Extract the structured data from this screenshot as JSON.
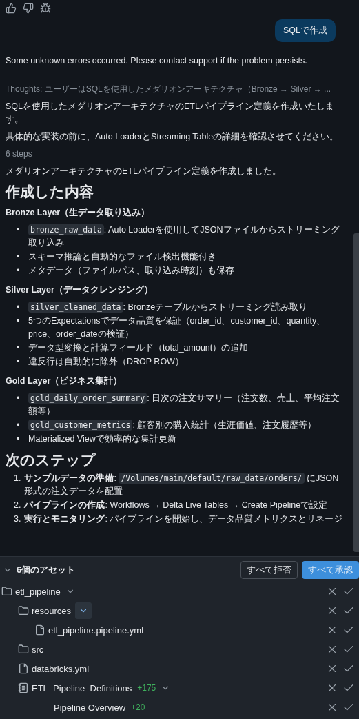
{
  "message_actions": [
    {
      "kind": "like"
    },
    {
      "kind": "dislike"
    },
    {
      "kind": "bug"
    }
  ],
  "user_message": "SQLで作成",
  "error": "Some unknown errors occurred. Please contact support if the problem persists.",
  "thoughts": "Thoughts: ユーザーはSQLを使用したメダリオンアーキテクチャ（Bronze → Silver → ...",
  "blocks": [
    {
      "kind": "paragraph",
      "text": "SQLを使用したメダリオンアーキテクチャのETLパイプライン定義を作成いたします。"
    },
    {
      "kind": "paragraph",
      "text": "具体的な実装の前に、Auto LoaderとStreaming Tableの詳細を確認させてください。"
    },
    {
      "kind": "steps",
      "text": "6 steps"
    },
    {
      "kind": "paragraph",
      "text": "メダリオンアーキテクチャのETLパイプライン定義を作成しました。"
    },
    {
      "kind": "heading",
      "text": "作成した内容"
    },
    {
      "kind": "subheading",
      "text": "Bronze Layer（生データ取り込み）"
    },
    {
      "kind": "list",
      "items": [
        {
          "marker": "•",
          "parts": [
            {
              "kind": "code",
              "text": "bronze_raw_data"
            },
            {
              "kind": "text",
              "text": ": Auto Loaderを使用してJSONファイルからストリーミング取り込み"
            }
          ]
        },
        {
          "marker": "•",
          "parts": [
            {
              "kind": "text",
              "text": "スキーマ推論と自動的なファイル検出機能付き"
            }
          ]
        },
        {
          "marker": "•",
          "parts": [
            {
              "kind": "text",
              "text": "メタデータ（ファイルパス、取り込み時刻）も保存"
            }
          ]
        }
      ]
    },
    {
      "kind": "subheading",
      "text": "Silver Layer（データクレンジング）"
    },
    {
      "kind": "list",
      "items": [
        {
          "marker": "•",
          "parts": [
            {
              "kind": "code",
              "text": "silver_cleaned_data"
            },
            {
              "kind": "text",
              "text": ": Bronzeテーブルからストリーミング読み取り"
            }
          ]
        },
        {
          "marker": "•",
          "parts": [
            {
              "kind": "text",
              "text": "5つのExpectationsでデータ品質を保証（order_id、customer_id、quantity、price、order_dateの検証）"
            }
          ]
        },
        {
          "marker": "•",
          "parts": [
            {
              "kind": "text",
              "text": "データ型変換と計算フィールド（total_amount）の追加"
            }
          ]
        },
        {
          "marker": "•",
          "parts": [
            {
              "kind": "text",
              "text": "違反行は自動的に除外（DROP ROW）"
            }
          ]
        }
      ]
    },
    {
      "kind": "subheading",
      "text": "Gold Layer（ビジネス集計）"
    },
    {
      "kind": "list",
      "items": [
        {
          "marker": "•",
          "parts": [
            {
              "kind": "code",
              "text": "gold_daily_order_summary"
            },
            {
              "kind": "text",
              "text": ": 日次の注文サマリー（注文数、売上、平均注文額等）"
            }
          ]
        },
        {
          "marker": "•",
          "parts": [
            {
              "kind": "code",
              "text": "gold_customer_metrics"
            },
            {
              "kind": "text",
              "text": ": 顧客別の購入統計（生涯価値、注文履歴等）"
            }
          ]
        },
        {
          "marker": "•",
          "parts": [
            {
              "kind": "text",
              "text": "Materialized Viewで効率的な集計更新"
            }
          ]
        }
      ]
    },
    {
      "kind": "heading",
      "text": "次のステップ"
    },
    {
      "kind": "numbered",
      "items": [
        {
          "marker": "1.",
          "parts": [
            {
              "kind": "text",
              "text": "**サンプルデータの準備**: "
            },
            {
              "kind": "code",
              "text": "/Volumes/main/default/raw_data/orders/"
            },
            {
              "kind": "text",
              "text": " にJSON形式の注文データを配置"
            }
          ]
        },
        {
          "marker": "2.",
          "parts": [
            {
              "kind": "text",
              "text": "**パイプラインの作成**: Workflows → Delta Live Tables → Create Pipelineで設定"
            }
          ]
        },
        {
          "marker": "3.",
          "parts": [
            {
              "kind": "text",
              "text": "**実行とモニタリング**: パイプラインを開始し、データ品質メトリクスとリネージ"
            }
          ]
        }
      ]
    }
  ],
  "assets": {
    "title": "6個のアセット",
    "expanded": true,
    "reject_all": "すべて拒否",
    "approve_all": "すべて承認",
    "tree": [
      {
        "kind": "folder",
        "name": "etl_pipeline",
        "expanded": true,
        "highlighted": false,
        "children": [
          {
            "kind": "folder",
            "name": "resources",
            "expanded": true,
            "highlighted": true,
            "children": [
              {
                "kind": "file",
                "name": "etl_pipeline.pipeline.yml"
              }
            ]
          },
          {
            "kind": "folder",
            "name": "src"
          },
          {
            "kind": "file",
            "name": "databricks.yml"
          },
          {
            "kind": "notebook",
            "name": "ETL_Pipeline_Definitions",
            "added": "+175",
            "expanded": true,
            "highlighted": false,
            "children": [
              {
                "kind": "section",
                "name": "Pipeline Overview",
                "added": "+20"
              }
            ]
          }
        ]
      }
    ]
  }
}
